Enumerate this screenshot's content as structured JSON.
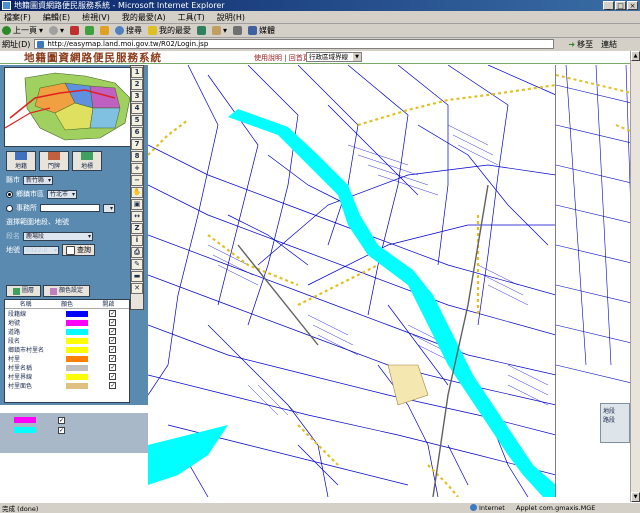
{
  "window": {
    "title": "地籍圖資網路便民服務系統 - Microsoft Internet Explorer",
    "buttons": [
      "_",
      "□",
      "×"
    ]
  },
  "menu": [
    "檔案(F)",
    "編輯(E)",
    "檢視(V)",
    "我的最愛(A)",
    "工具(T)",
    "說明(H)"
  ],
  "toolbar": {
    "back": "上一頁",
    "search": "搜尋",
    "favorites": "我的最愛",
    "history": "媒體"
  },
  "address": {
    "label": "網址(D)",
    "url": "http://easymap.land.moi.gov.tw/R02/Login.jsp",
    "go": "移至",
    "links": "連結"
  },
  "app": {
    "title": "地籍圖資網路便民服務系統",
    "header_links": "使用說明 | 回首頁",
    "layer_select": "行政區域界線"
  },
  "panel": {
    "tabs": [
      "地籍",
      "門牌",
      "地標"
    ],
    "county_label": "縣市",
    "county_value": "新竹縣",
    "option1_label": "鄉鎮市區",
    "option1_value": "竹北市",
    "option2_label": "事務所",
    "choose_label": "選擇範圍地段、地號",
    "section_label": "段名",
    "section_value": "鹿場段",
    "landno_label": "地號",
    "landno_value": "0322-0",
    "query_button": "查詢"
  },
  "legend": {
    "tabs": [
      "圖層",
      "顏色設定"
    ],
    "headers": [
      "名稱",
      "顏色",
      "開啟"
    ],
    "rows": [
      {
        "name": "段籍線",
        "color": "#0000ff",
        "checked": true
      },
      {
        "name": "地號",
        "color": "#ff00ff",
        "checked": true
      },
      {
        "name": "道路",
        "color": "#00ffff",
        "checked": true
      },
      {
        "name": "段名",
        "color": "#ffff00",
        "checked": true
      },
      {
        "name": "鄉鎮市村里名",
        "color": "#ffff00",
        "checked": true
      },
      {
        "name": "村里",
        "color": "#ff8000",
        "checked": true
      },
      {
        "name": "村里名稱",
        "color": "#c0c0c0",
        "checked": true
      },
      {
        "name": "村里界線",
        "color": "#ffff00",
        "checked": true
      },
      {
        "name": "村里面色",
        "color": "#e0c080",
        "checked": true
      }
    ]
  },
  "zoom_toolbar": [
    "1",
    "2",
    "3",
    "4",
    "5",
    "6",
    "7",
    "8"
  ],
  "right_panel": {
    "rows": [
      "地段",
      "路段"
    ]
  },
  "status": {
    "left": "完成 (done)",
    "zone": "Internet",
    "applet": "Applet com.gmaxis.MGE"
  }
}
